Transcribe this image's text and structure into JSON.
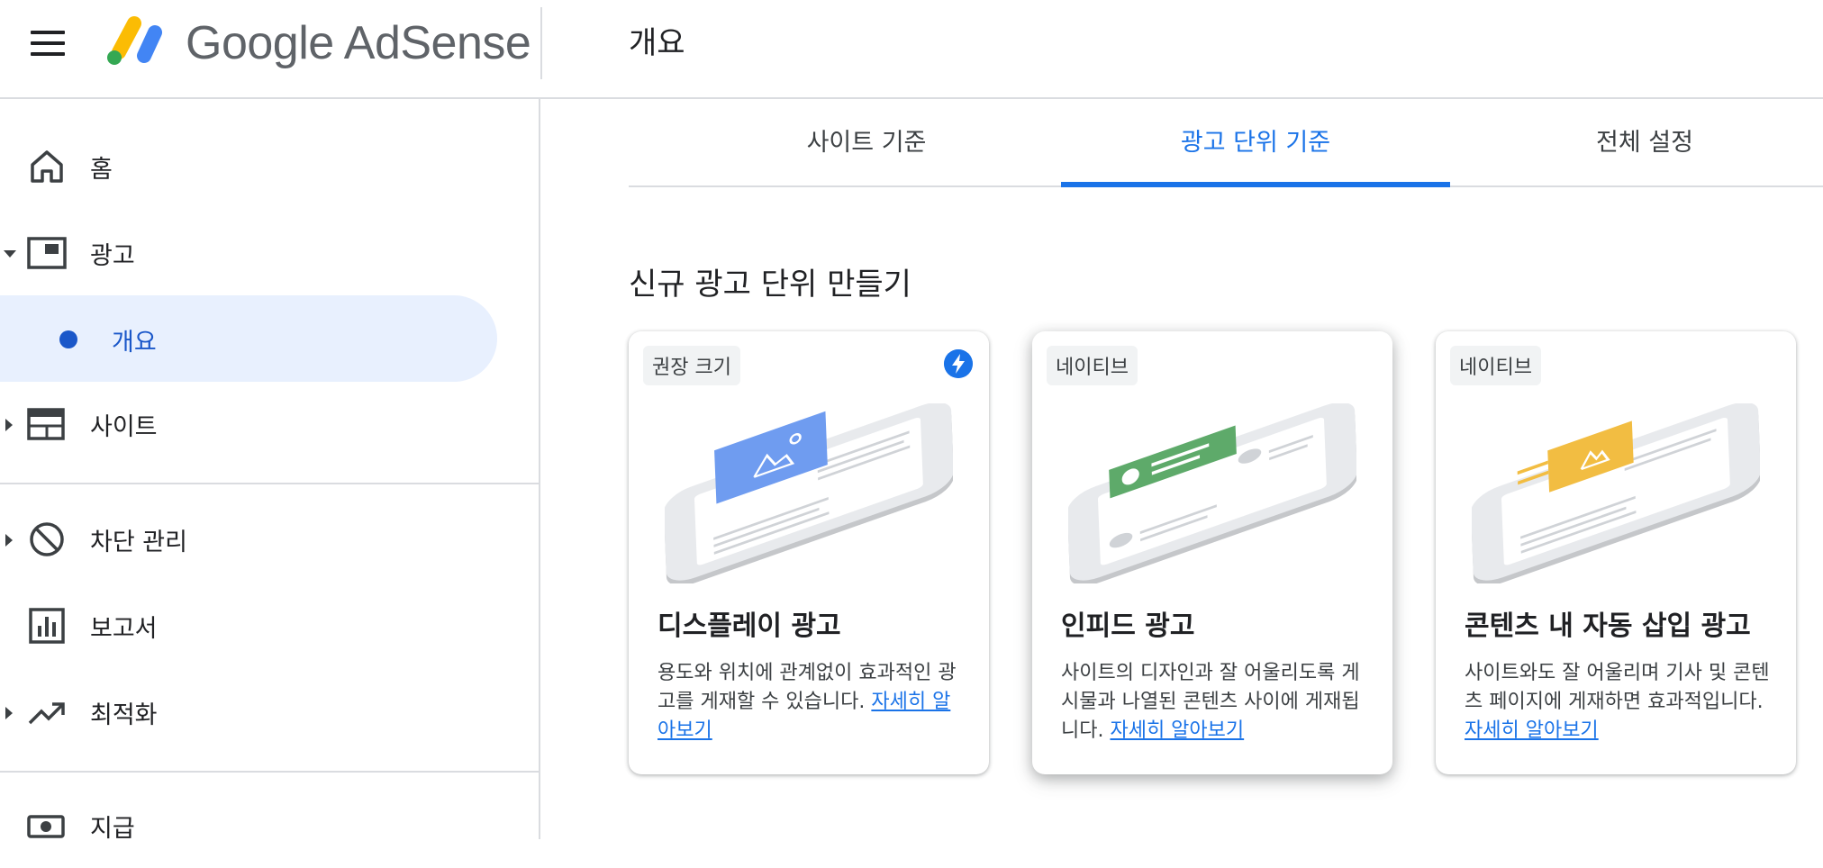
{
  "app": {
    "logo_text": "Google AdSense",
    "page_title": "개요"
  },
  "sidebar": {
    "items": [
      {
        "label": "홈",
        "icon": "home-icon"
      },
      {
        "label": "광고",
        "icon": "ad-icon",
        "expanded": true
      },
      {
        "label": "개요",
        "selected": true
      },
      {
        "label": "사이트",
        "icon": "site-icon"
      },
      {
        "label": "차단 관리",
        "icon": "block-icon"
      },
      {
        "label": "보고서",
        "icon": "report-icon"
      },
      {
        "label": "최적화",
        "icon": "trending-up-icon"
      },
      {
        "label": "지급",
        "icon": "payment-icon"
      }
    ]
  },
  "tabs": [
    {
      "label": "사이트 기준",
      "active": false
    },
    {
      "label": "광고 단위 기준",
      "active": true
    },
    {
      "label": "전체 설정",
      "active": false
    }
  ],
  "section_title": "신규 광고 단위 만들기",
  "cards": [
    {
      "chip": "권장 크기",
      "has_bolt": true,
      "title": "디스플레이 광고",
      "desc": "용도와 위치에 관계없이 효과적인 광고를 게재할 수 있습니다. ",
      "link": "자세히 알아보기"
    },
    {
      "chip": "네이티브",
      "has_bolt": false,
      "title": "인피드 광고",
      "desc": "사이트의 디자인과 잘 어울리도록 게시물과 나열된 콘텐츠 사이에 게재됩니다. ",
      "link": "자세히 알아보기"
    },
    {
      "chip": "네이티브",
      "has_bolt": false,
      "title": "콘텐츠 내 자동 삽입 광고",
      "desc": "사이트와도 잘 어울리며 기사 및 콘텐츠 페이지에 게재하면 효과적입니다. ",
      "link": "자세히 알아보기"
    }
  ],
  "colors": {
    "accent": "#1a73e8",
    "selected_bg": "#e8f0fe",
    "display_ad": "#6f9cf0",
    "infeed_ad": "#5eaa6a",
    "inarticle_ad": "#f2bd42"
  }
}
